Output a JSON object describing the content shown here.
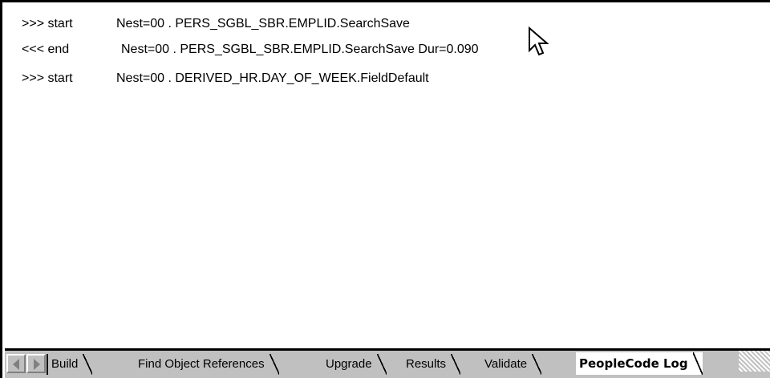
{
  "log": {
    "lines": [
      {
        "kind": ">>> start",
        "text": "Nest=00 . PERS_SGBL_SBR.EMPLID.SearchSave"
      },
      {
        "kind": "<<< end",
        "text": "Nest=00 . PERS_SGBL_SBR.EMPLID.SearchSave Dur=0.090"
      },
      {
        "kind": ">>> start",
        "text": "Nest=00 . DERIVED_HR.DAY_OF_WEEK.FieldDefault"
      }
    ]
  },
  "tabs": [
    {
      "label": "Build",
      "active": false
    },
    {
      "label": "Find Object References",
      "active": false
    },
    {
      "label": "Upgrade",
      "active": false
    },
    {
      "label": "Results",
      "active": false
    },
    {
      "label": "Validate",
      "active": false
    },
    {
      "label": "PeopleCode Log",
      "active": true
    }
  ],
  "icons": {
    "scroll_left": "triangle-left-icon",
    "scroll_right": "triangle-right-icon",
    "cursor": "mouse-pointer-icon"
  },
  "colors": {
    "tab_strip": "#c0c0c0",
    "background": "#ffffff",
    "border": "#000000"
  }
}
